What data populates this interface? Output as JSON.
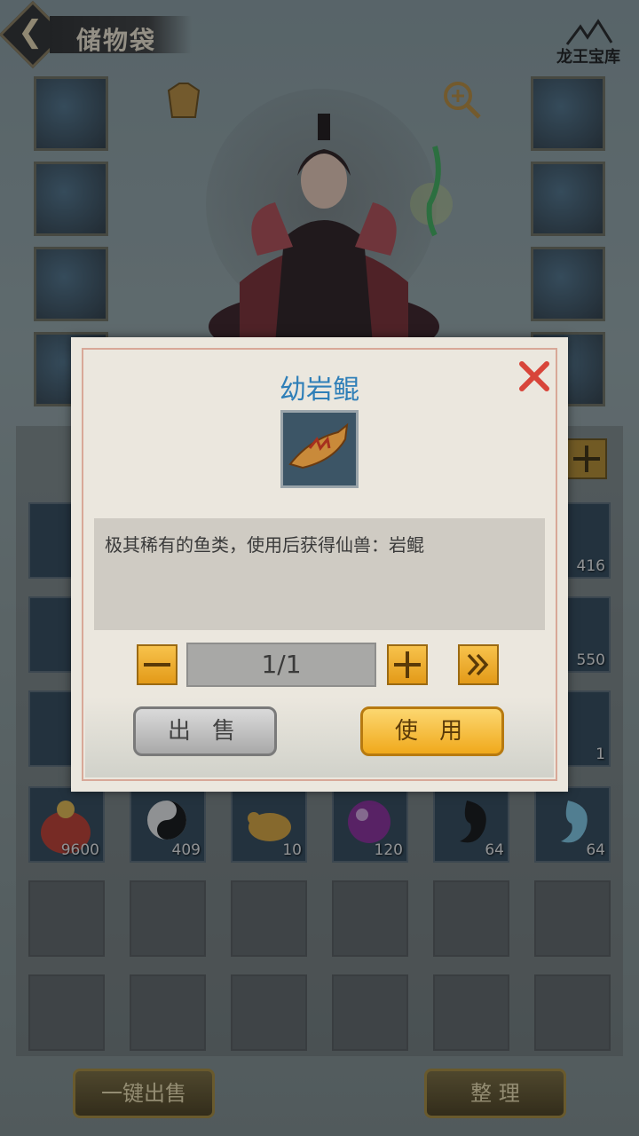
{
  "header": {
    "title": "储物袋",
    "brand": "龙王宝库"
  },
  "equipment": {
    "left": [
      "weapon-icon",
      "helmet-icon",
      "armor-icon",
      "boots-icon"
    ],
    "right": [
      "ring-icon",
      "amulet-icon",
      "bracelet-icon",
      "belt-icon"
    ]
  },
  "grid": {
    "rows": [
      [
        {
          "icon": "purple-gem-icon",
          "count": ""
        },
        {
          "icon": "item-icon",
          "count": ""
        },
        {
          "icon": "item-icon",
          "count": ""
        },
        {
          "icon": "item-icon",
          "count": ""
        },
        {
          "icon": "item-icon",
          "count": ""
        },
        {
          "icon": "blue-crystal-icon",
          "count": "416"
        }
      ],
      [
        {
          "icon": "purple-crystal-icon",
          "count": ""
        },
        {
          "icon": "item-icon",
          "count": ""
        },
        {
          "icon": "item-icon",
          "count": ""
        },
        {
          "icon": "item-icon",
          "count": ""
        },
        {
          "icon": "item-icon",
          "count": ""
        },
        {
          "icon": "dark-crystal-icon",
          "count": "550"
        }
      ],
      [
        {
          "icon": "green-book-icon",
          "count": ""
        },
        {
          "icon": "item-icon",
          "count": ""
        },
        {
          "icon": "item-icon",
          "count": ""
        },
        {
          "icon": "item-icon",
          "count": ""
        },
        {
          "icon": "item-icon",
          "count": ""
        },
        {
          "icon": "fish-icon",
          "count": "1"
        }
      ],
      [
        {
          "icon": "money-bag-icon",
          "count": "9600"
        },
        {
          "icon": "yin-yang-icon",
          "count": "409"
        },
        {
          "icon": "golden-rat-icon",
          "count": "10"
        },
        {
          "icon": "purple-orb-icon",
          "count": "120"
        },
        {
          "icon": "black-magatama-icon",
          "count": "64"
        },
        {
          "icon": "blue-magatama-icon",
          "count": "64"
        }
      ]
    ]
  },
  "bottom": {
    "sell_all": "一键出售",
    "sort": "整 理"
  },
  "modal": {
    "title": "幼岩鲲",
    "description": "极其稀有的鱼类，使用后获得仙兽：岩鲲",
    "quantity": "1/1",
    "sell": "出 售",
    "use": "使 用"
  },
  "colors": {
    "title_blue": "#2f7fb8",
    "gold_button": "#f0a91c",
    "close_red": "#d8453a"
  }
}
